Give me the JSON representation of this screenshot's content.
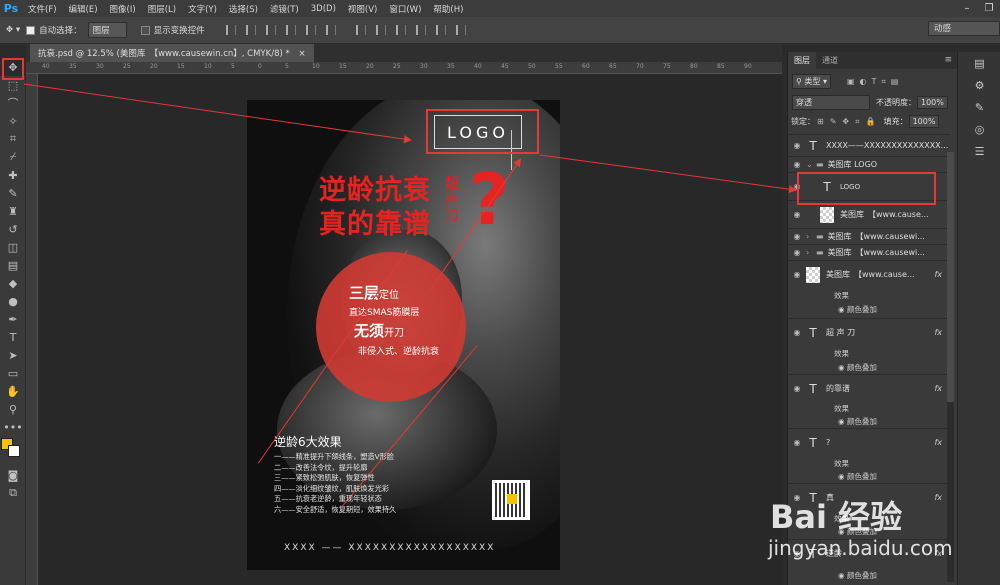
{
  "app": {
    "logo": "Ps"
  },
  "menu": [
    "文件(F)",
    "编辑(E)",
    "图像(I)",
    "图层(L)",
    "文字(Y)",
    "选择(S)",
    "滤镜(T)",
    "3D(D)",
    "视图(V)",
    "窗口(W)",
    "帮助(H)"
  ],
  "options": {
    "auto_select_label": "自动选择：",
    "auto_select_value": "图层",
    "show_transform_label": "显示变换控件",
    "workspace": "动感"
  },
  "document": {
    "tab_title": "抗衰.psd @ 12.5% (美图库　【www.causewin.cn】, CMYK/8) *",
    "close": "×"
  },
  "ruler_numbers": [
    "40",
    "35",
    "30",
    "25",
    "20",
    "15",
    "10",
    "5",
    "0",
    "5",
    "10",
    "15",
    "20",
    "25",
    "30",
    "35",
    "40",
    "45",
    "50",
    "55",
    "60",
    "65",
    "70",
    "75",
    "80",
    "85",
    "90"
  ],
  "poster": {
    "logo": "LOGO",
    "title_line1": "逆龄抗衰",
    "title_line2": "真的靠谱",
    "side_text": [
      "超",
      "声",
      "刀"
    ],
    "question": "?",
    "circle_line1_big": "三层",
    "circle_line1_small": "定位",
    "circle_line2": "直达SMAS筋膜层",
    "circle_line3_big": "无须",
    "circle_line3_small": "开刀",
    "circle_line4": "非侵入式、逆龄抗衰",
    "effects_title": "逆龄6大效果",
    "effects": [
      "一——精准提升下颌线条，塑造V形脸",
      "二——改善法令纹，提升轮廓",
      "三——紧致松弛肌肤，恢复弹性",
      "四——淡化细纹皱纹，肌肤焕发光彩",
      "五——抗衰老逆龄，重现年轻状态",
      "六——安全舒适，恢复期短，效果持久"
    ],
    "footer": "XXXX —— XXXXXXXXXXXXXXXXXX"
  },
  "layers_panel": {
    "tabs": [
      "图层",
      "通道"
    ],
    "filter_label": "类型",
    "blend_mode": "穿透",
    "opacity_label": "不透明度：",
    "opacity_value": "100%",
    "lock_label": "锁定：",
    "fill_label": "填充：",
    "fill_value": "100%",
    "layers": [
      {
        "name": "XXXX——XXXXXXXXXXXXXX...",
        "kind": "text"
      },
      {
        "name": "美图库 LOGO",
        "kind": "group"
      },
      {
        "name": "LOGO",
        "kind": "text"
      },
      {
        "name": "美图库　【www.cause...",
        "kind": "image"
      },
      {
        "name": "美图库　【www.causewi...",
        "kind": "group"
      },
      {
        "name": "美图库　【www.causewi...",
        "kind": "group"
      },
      {
        "name": "美图库　【www.cause...",
        "kind": "image",
        "fx": "fx"
      },
      {
        "name": "超 声 刀",
        "kind": "text",
        "fx": "fx"
      },
      {
        "name": "的靠谱",
        "kind": "text",
        "fx": "fx"
      },
      {
        "name": "?",
        "kind": "text",
        "fx": "fx"
      },
      {
        "name": "真",
        "kind": "text",
        "fx": "fx"
      },
      {
        "name": "逆龄",
        "kind": "text",
        "fx": "fx"
      }
    ],
    "effect_label": "效果",
    "color_overlay": "颜色叠加"
  },
  "watermark": {
    "brand": "Bai 经验",
    "domain": "jingyan.baidu.com"
  },
  "accent": "#e53935"
}
